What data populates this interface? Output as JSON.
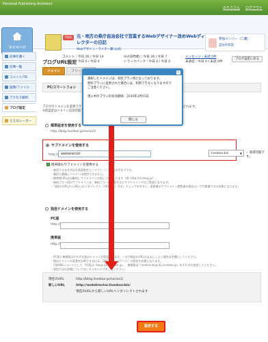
{
  "topbar": {
    "brand": "Personal Publishing Architect",
    "user": "のりささん",
    "logout": "ログアウト"
  },
  "header": {
    "mypage_label": "マイページ",
    "badge": "FREE",
    "blog_title": "元・地方の県庁自治会社で営業するWebデザイナー改めWebディレクターの日記",
    "blog_sub": "Webデザイン・ライター賞(公式)",
    "stats_line1": "コメント｜今日 26 / 今日 14",
    "stats_line2": "コメント｜今日 0 / 今日 0",
    "stats_line3": "UU(訪問者)｜今日 26 / 今日 7",
    "stats_line4": "トラックバック｜今日 0 / 今日 0",
    "stats_line5": "メッセージ｜未読 0件",
    "stats_line6": "未承認｜今日 0 / 未読 0件",
    "acct_top": "参加メンバー（二層）",
    "acct_bottom": "自分の日誌"
  },
  "sidebar": {
    "items": [
      {
        "label": "記事を書く"
      },
      {
        "label": "記事一覧"
      },
      {
        "label": "コメント/TB"
      },
      {
        "label": "画像/ファイル"
      },
      {
        "label": "アクセス解析"
      },
      {
        "label": "ブログ設定"
      },
      {
        "label": "ええなレーカー"
      }
    ]
  },
  "main": {
    "page_title": "ブログURL設定",
    "back_button": "ブログ設定に戻る",
    "tabs": [
      "ドメイン",
      "フリーブログ"
    ],
    "pc_row_left": "PC/スマートフォン",
    "pc_row_right": "",
    "intro_line1": "ブログのドメインを変更できます。変更前のブログURLで記事にアクセスした場合は変更後のURLへ移動されます。",
    "intro_line2": "※新設定はドメイン追加可能です。",
    "opt1_label": "標準設定を使用する",
    "opt1_url": "http://blog.livedoor.jp/norisa1/",
    "sub_label": "サブドメインを使用する",
    "sub_prefix": "http://",
    "sub_value": "webdirector",
    "domain_select": "livedoor.biz",
    "available_text": "取得可能です。",
    "check_mark": "✓",
    "cb_label": "携帯版もサブドメインを使用する",
    "notes": [
      "・使用できる文字は半角英数字とハイフン（-）で16文字までです。",
      "・最初と最後にハイフンは使用できません。",
      "・携帯版URLは自動的にサブドメインの前に m が入ります（例: http://m.blog.jp/）。",
      "・無料プラン用のサブドメインは、無料プランに変更するとサブドメインでのご覧道となります。",
      "・「現在のURLからURLへのリダイレクト（URL転送）する」チェックを外すと、変更後のサブドメイン閲覧者の既存ユーザが影響できる状態になります。"
    ],
    "opt3_label": "独自ドメインを使用する",
    "pc_header": "PC版",
    "pc_prefix": "http://",
    "mobile_header": "携帯版",
    "mobile_prefix": "http://",
    "notes2": [
      "・PC版と携帯版はそれぞれ別のドメインが設定出来ます。一方が指定のURLのままにしたい場合は空欄にしてください。",
      "・独自ドメインの変更を反映させるには、DNS（ネームサーバ）の設定が必要となります。",
      "　CNAMEレコードとして、PC版は「blog-01.livedoor.jp」、携帯版は「mobile-blog-01.livedoor.jp」をそれぞれ設定してください。",
      "・設定方法の詳細についてはこちらのヘルプをご覧ください。"
    ],
    "current_url_label": "現在のURL",
    "current_url": "http://blog.livedoor.jp/norisa1/",
    "new_url_label": "新しいURL",
    "new_url": "http://webdirector.livedoor.biz/",
    "redirect_text": "現在のURLから新しいURLへリダイレクトされます",
    "save_button": "設定する"
  },
  "modal": {
    "line1": "選択したドメインは、有料プラン用となっております。",
    "line2": "無料プランに変更された場合には、利用できなくなりますので",
    "line3": "ご注意ください。",
    "line4": "",
    "line5": "現入中のプランの有効期限：2030年3月01日",
    "button": "閉じる",
    "close": "×"
  },
  "colors": {
    "accent": "#e0201b",
    "save": "#f07a14",
    "tab_active": "#d9922a",
    "modal_border": "#3b87c4"
  }
}
